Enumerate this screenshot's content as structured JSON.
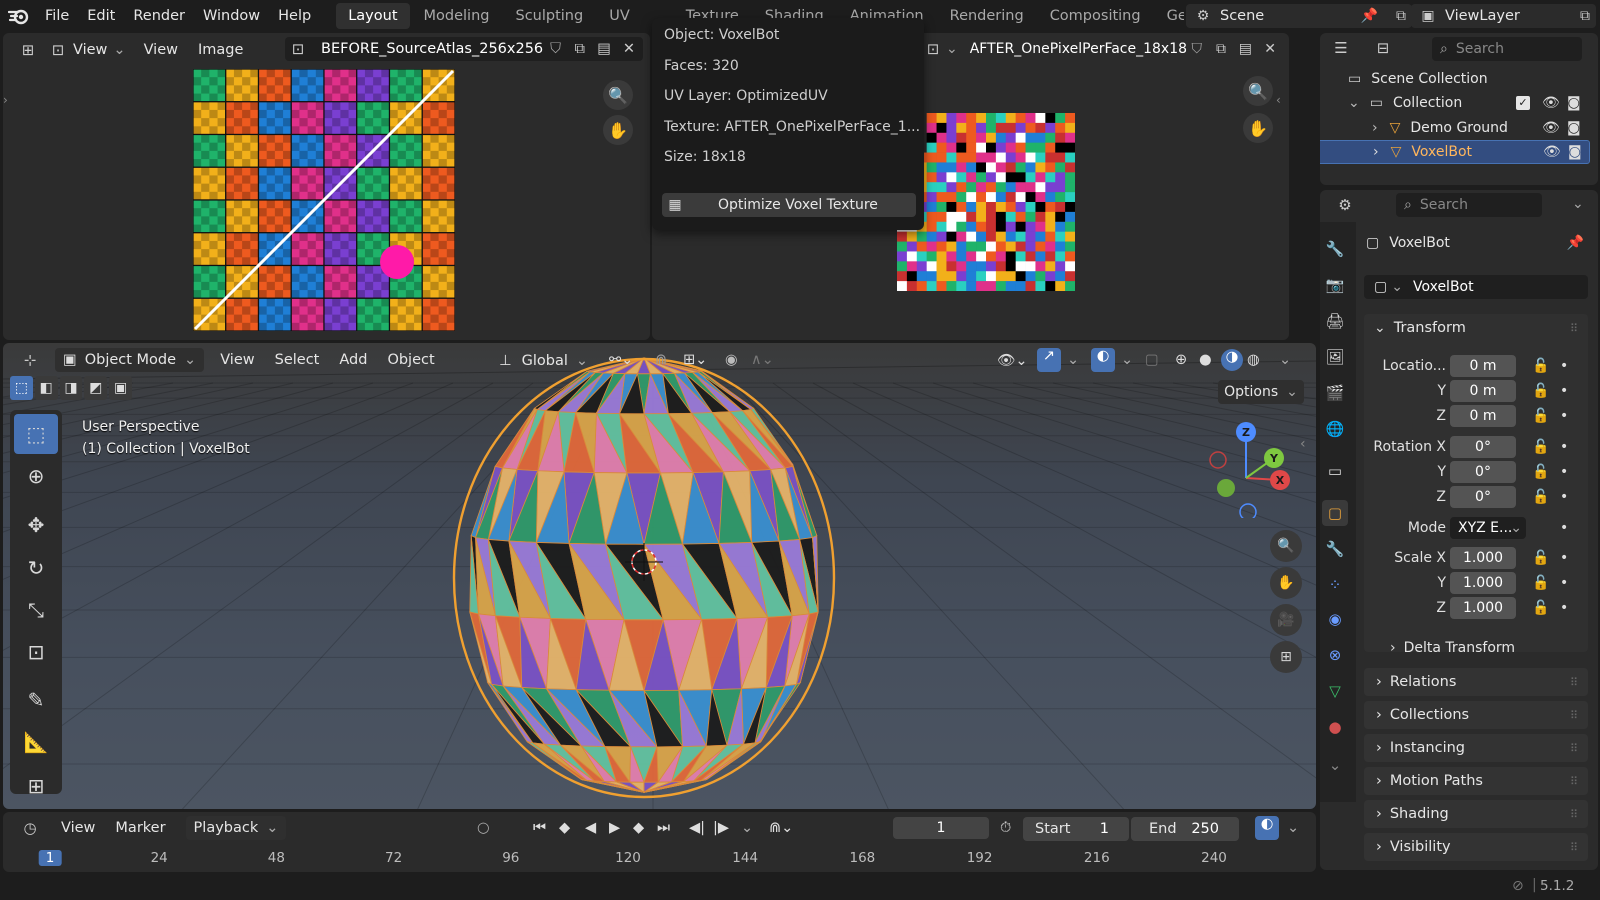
{
  "menu": [
    "File",
    "Edit",
    "Render",
    "Window",
    "Help"
  ],
  "workspaces": [
    {
      "label": "Layout",
      "active": true
    },
    {
      "label": "Modeling"
    },
    {
      "label": "Sculpting"
    },
    {
      "label": "UV Editing"
    },
    {
      "label": "Texture Paint"
    },
    {
      "label": "Shading"
    },
    {
      "label": "Animation"
    },
    {
      "label": "Rendering"
    },
    {
      "label": "Compositing"
    },
    {
      "label": "Geom"
    }
  ],
  "scene": "Scene",
  "view_layer": "ViewLayer",
  "image_editor_left": {
    "view_menu": "View",
    "menus": [
      "View",
      "Image"
    ],
    "image_name": "BEFORE_SourceAtlas_256x256"
  },
  "image_editor_right": {
    "image_name": "AFTER_OnePixelPerFace_18x18"
  },
  "tooltip": {
    "object": "Object: VoxelBot",
    "faces": "Faces: 320",
    "uv_layer": "UV Layer: OptimizedUV",
    "texture": "Texture: AFTER_OnePixelPerFace_1...",
    "size": "Size: 18x18",
    "button": "Optimize Voxel Texture"
  },
  "outliner": {
    "search_placeholder": "Search",
    "scene_collection": "Scene Collection",
    "items": [
      {
        "label": "Collection"
      },
      {
        "label": "Demo Ground"
      },
      {
        "label": "VoxelBot",
        "selected": true
      }
    ]
  },
  "properties": {
    "search_placeholder": "Search",
    "object_name": "VoxelBot",
    "datablock": "VoxelBot",
    "transform_title": "Transform",
    "location_label": "Locatio...",
    "rotation_label": "Rotation X",
    "scale_label": "Scale X",
    "mode_label": "Mode",
    "mode_value": "XYZ E...",
    "axis_y": "Y",
    "axis_z": "Z",
    "location": [
      "0 m",
      "0 m",
      "0 m"
    ],
    "rotation": [
      "0°",
      "0°",
      "0°"
    ],
    "scale": [
      "1.000",
      "1.000",
      "1.000"
    ],
    "delta": "Delta Transform",
    "sections": [
      "Relations",
      "Collections",
      "Instancing",
      "Motion Paths",
      "Shading",
      "Visibility"
    ]
  },
  "viewport": {
    "mode": "Object Mode",
    "menus": [
      "View",
      "Select",
      "Add",
      "Object"
    ],
    "orientation": "Global",
    "options": "Options",
    "overlay_line1": "User Perspective",
    "overlay_line2": "(1) Collection | VoxelBot",
    "gizmo": {
      "x": "X",
      "y": "Y",
      "z": "Z"
    }
  },
  "timeline": {
    "menus": [
      "View",
      "Marker"
    ],
    "playback": "Playback",
    "current_frame": "1",
    "start_label": "Start",
    "start": "1",
    "end_label": "End",
    "end": "250",
    "ticks": [
      "1",
      "24",
      "48",
      "72",
      "96",
      "120",
      "144",
      "168",
      "192",
      "216",
      "240"
    ]
  },
  "status": {
    "version": "5.1.2"
  },
  "colors": {
    "accent": "#4772b3",
    "selected_row": "#334d80",
    "orange": "#e8a23a"
  }
}
